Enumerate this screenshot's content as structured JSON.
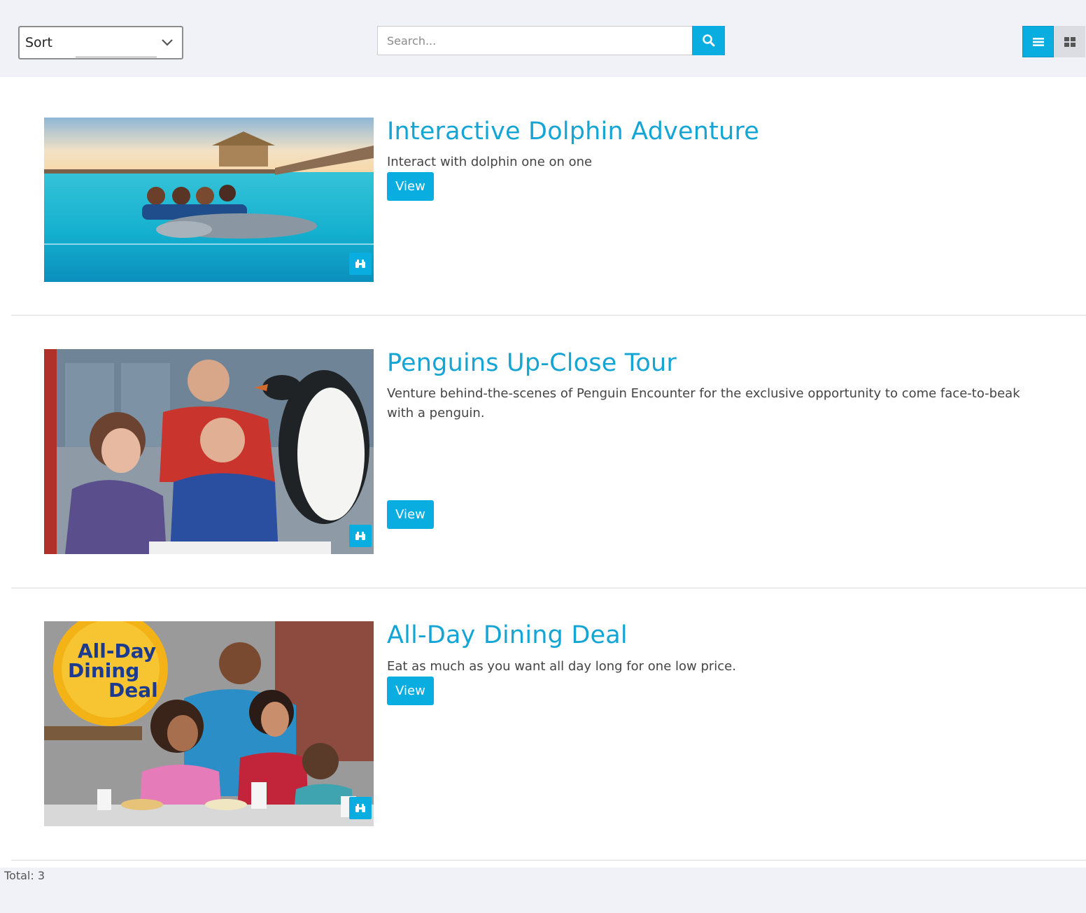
{
  "toolbar": {
    "sort_label": "Sort",
    "search_placeholder": "Search...",
    "icons": {
      "search": "search-icon",
      "sort_dropdown": "chevron-down-icon",
      "list_view": "list-view-icon",
      "grid_view": "grid-view-icon"
    },
    "active_view": "list"
  },
  "colors": {
    "accent": "#0aade0",
    "title": "#15a5d4",
    "page_bg": "#f1f2f7"
  },
  "items": [
    {
      "title": "Interactive Dolphin Adventure",
      "description": "Interact with dolphin one on one",
      "button": "View",
      "badge_icon": "binoculars-icon"
    },
    {
      "title": "Penguins Up-Close Tour",
      "description": "Venture behind-the-scenes of Penguin Encounter for the exclusive opportunity to come face-to-beak with a penguin.",
      "button": "View",
      "badge_icon": "binoculars-icon"
    },
    {
      "title": "All-Day Dining Deal",
      "description": "Eat as much as you want all day long for one low price.",
      "button": "View",
      "badge_icon": "binoculars-icon",
      "image_logo_text": [
        "All-Day",
        "Dining",
        "Deal"
      ]
    }
  ],
  "footer": {
    "total": "Total: 3"
  }
}
